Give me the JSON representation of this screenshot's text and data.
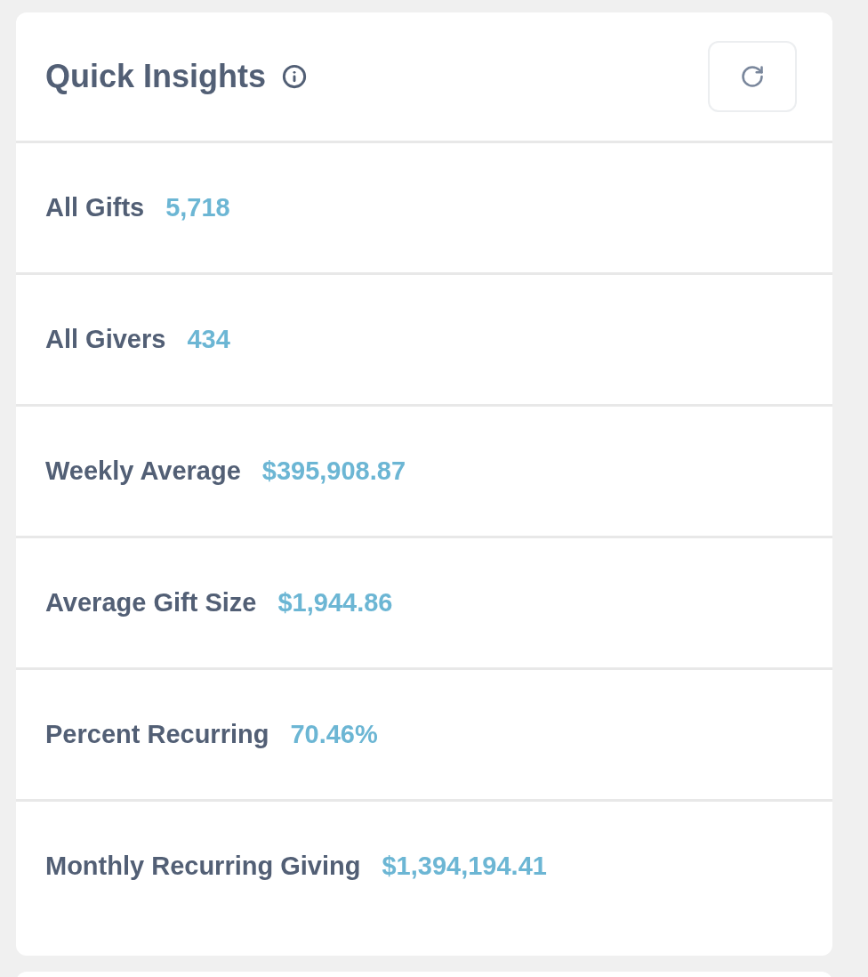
{
  "card": {
    "title": "Quick Insights"
  },
  "insights": [
    {
      "label": "All Gifts",
      "value": "5,718"
    },
    {
      "label": "All Givers",
      "value": "434"
    },
    {
      "label": "Weekly Average",
      "value": "$395,908.87"
    },
    {
      "label": "Average Gift Size",
      "value": "$1,944.86"
    },
    {
      "label": "Percent Recurring",
      "value": "70.46%"
    },
    {
      "label": "Monthly Recurring Giving",
      "value": "$1,394,194.41"
    }
  ]
}
